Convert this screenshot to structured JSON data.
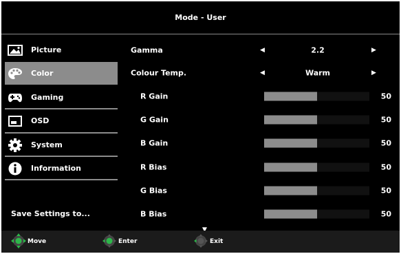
{
  "title": "Mode - User",
  "sidebar": {
    "items": [
      {
        "label": "Picture",
        "icon": "picture-icon"
      },
      {
        "label": "Color",
        "icon": "palette-icon",
        "active": true
      },
      {
        "label": "Gaming",
        "icon": "gamepad-icon"
      },
      {
        "label": "OSD",
        "icon": "osd-icon"
      },
      {
        "label": "System",
        "icon": "gear-icon"
      },
      {
        "label": "Information",
        "icon": "info-icon"
      }
    ],
    "save_label": "Save Settings to..."
  },
  "settings": {
    "gamma": {
      "label": "Gamma",
      "value": "2.2"
    },
    "colour_temp": {
      "label": "Colour Temp.",
      "value": "Warm"
    },
    "r_gain": {
      "label": "R Gain",
      "value": "50"
    },
    "g_gain": {
      "label": "G Gain",
      "value": "50"
    },
    "b_gain": {
      "label": "B Gain",
      "value": "50"
    },
    "r_bias": {
      "label": "R Bias",
      "value": "50"
    },
    "g_bias": {
      "label": "G Bias",
      "value": "50"
    },
    "b_bias": {
      "label": "B Bias",
      "value": "50"
    }
  },
  "footer": {
    "move": "Move",
    "enter": "Enter",
    "exit": "Exit"
  },
  "colors": {
    "accent_green": "#2db84a",
    "highlight_gray": "#8c8c8c",
    "background": "#000000"
  }
}
